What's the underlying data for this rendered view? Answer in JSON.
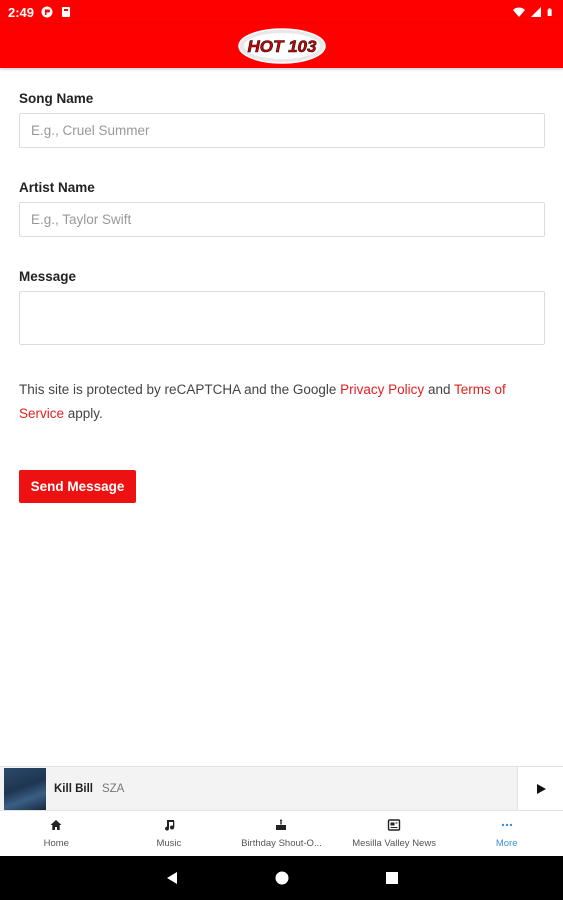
{
  "status_bar": {
    "time": "2:49"
  },
  "header": {
    "logo_text": "HOT 103",
    "logo_icon": "hot-103-logo"
  },
  "form": {
    "song": {
      "label": "Song Name",
      "placeholder": "E.g., Cruel Summer"
    },
    "artist": {
      "label": "Artist Name",
      "placeholder": "E.g., Taylor Swift"
    },
    "message": {
      "label": "Message",
      "placeholder": ""
    },
    "notice": {
      "prefix": "This site is protected by reCAPTCHA and the Google ",
      "privacy_link": "Privacy Policy",
      "middle": " and ",
      "terms_link": "Terms of Service",
      "suffix": " apply."
    },
    "send_label": "Send Message"
  },
  "player": {
    "track": "Kill Bill",
    "artist": "SZA"
  },
  "nav": {
    "items": [
      {
        "label": "Home",
        "icon": "home-icon"
      },
      {
        "label": "Music",
        "icon": "music-note-icon"
      },
      {
        "label": "Birthday Shout-O...",
        "icon": "cake-icon"
      },
      {
        "label": "Mesilla Valley News",
        "icon": "news-icon"
      },
      {
        "label": "More",
        "icon": "more-icon"
      }
    ],
    "active_index": 4
  },
  "colors": {
    "brand": "#ff0000",
    "accent_link": "#e02020",
    "button": "#ee1111",
    "active_nav": "#3b8fd9"
  }
}
